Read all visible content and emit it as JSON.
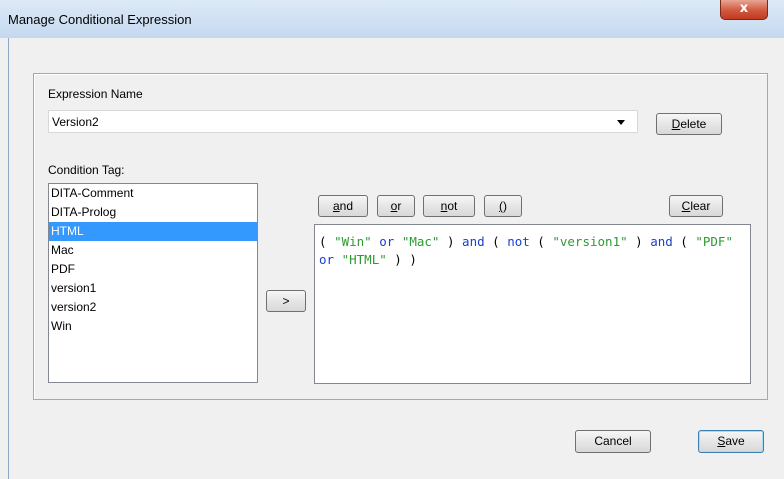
{
  "window": {
    "title": "Manage Conditional Expression",
    "close_label": "x"
  },
  "expression": {
    "label": "Expression Name",
    "value": "Version2"
  },
  "buttons": {
    "delete": "Delete",
    "add": ">",
    "and": "and",
    "or": "or",
    "not": "not",
    "parens": "()",
    "clear": "Clear",
    "cancel": "Cancel",
    "save": "Save"
  },
  "condition_tag": {
    "label": "Condition Tag:",
    "items": [
      "DITA-Comment",
      "DITA-Prolog",
      "HTML",
      "Mac",
      "PDF",
      "version1",
      "version2",
      "Win"
    ],
    "selected": "HTML"
  },
  "editor": {
    "text": "( \"Win\" or \"Mac\" ) and ( not ( \"version1\" ) and ( \"PDF\" or \"HTML\" ) )"
  },
  "colors": {
    "keyword": "#1a3fd0",
    "string": "#2e9a32",
    "selection": "#3399ff"
  }
}
